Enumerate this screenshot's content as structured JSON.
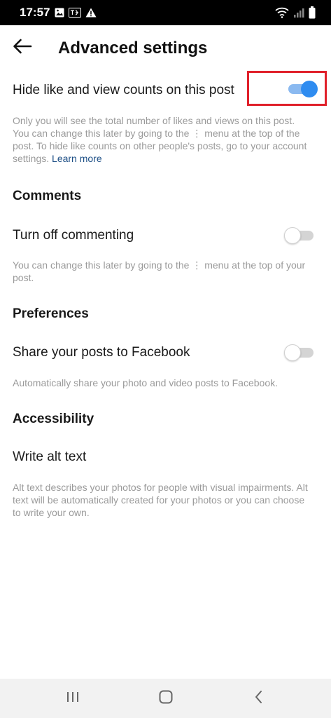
{
  "status_bar": {
    "time": "17:57",
    "left_icons": [
      "image-icon",
      "language-icon",
      "warning-icon"
    ],
    "right_icons": [
      "wifi-icon",
      "signal-icon",
      "battery-icon"
    ]
  },
  "header": {
    "back_icon": "arrow-left-icon",
    "title": "Advanced settings"
  },
  "hide_counts": {
    "label": "Hide like and view counts on this post",
    "enabled": true,
    "description": "Only you will see the total number of likes and views on this post. You can change this later by going to the ⋮ menu at the top of the post. To hide like counts on other people's posts, go to your account settings.",
    "link": "Learn more"
  },
  "comments": {
    "section_title": "Comments",
    "turn_off_label": "Turn off commenting",
    "enabled": false,
    "description": "You can change this later by going to the ⋮ menu at the top of your post."
  },
  "preferences": {
    "section_title": "Preferences",
    "share_label": "Share your posts to Facebook",
    "enabled": false,
    "description": "Automatically share your photo and video posts to Facebook."
  },
  "accessibility": {
    "section_title": "Accessibility",
    "alt_text_label": "Write alt text",
    "description": "Alt text describes your photos for people with visual impairments. Alt text will be automatically created for your photos or you can choose to write your own."
  },
  "nav_bar": {
    "icons": [
      "recent-apps-icon",
      "home-icon",
      "back-icon"
    ]
  },
  "colors": {
    "toggle_on": "#2f8cf0",
    "highlight": "#e0202a",
    "link": "#1d4f86"
  }
}
